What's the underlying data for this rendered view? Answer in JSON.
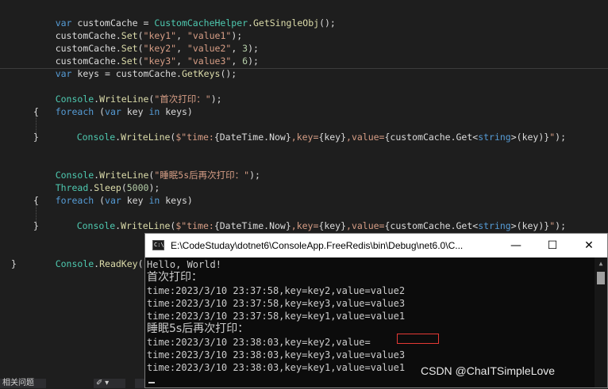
{
  "code": {
    "line1_a": "var",
    "line1_b": " customCache = ",
    "line1_c": "CustomCacheHelper",
    "line1_d": ".",
    "line1_e": "GetSingleObj",
    "line1_f": "();",
    "line2_a": "customCache.",
    "line2_b": "Set",
    "line2_c": "(",
    "line2_d": "\"key1\"",
    "line2_e": ", ",
    "line2_f": "\"value1\"",
    "line2_g": ");",
    "line3_a": "customCache.",
    "line3_b": "Set",
    "line3_c": "(",
    "line3_d": "\"key2\"",
    "line3_e": ", ",
    "line3_f": "\"value2\"",
    "line3_g": ", ",
    "line3_h": "3",
    "line3_i": ");",
    "line4_a": "customCache.",
    "line4_b": "Set",
    "line4_c": "(",
    "line4_d": "\"key3\"",
    "line4_e": ", ",
    "line4_f": "\"value3\"",
    "line4_g": ", ",
    "line4_h": "6",
    "line4_i": ");",
    "line5_a": "var",
    "line5_b": " keys = customCache.",
    "line5_c": "GetKeys",
    "line5_d": "();",
    "line6_a": "Console",
    "line6_b": ".",
    "line6_c": "WriteLine",
    "line6_d": "(",
    "line6_e": "\"首次打印：\"",
    "line6_f": ");",
    "line7_a": "foreach",
    "line7_b": " (",
    "line7_c": "var",
    "line7_d": " key ",
    "line7_e": "in",
    "line7_f": " keys)",
    "brace_open": "{",
    "brace_close": "}",
    "wl_a": "Console",
    "wl_b": ".",
    "wl_c": "WriteLine",
    "wl_d": "(",
    "wl_e": "$\"time:",
    "wl_f": "{DateTime.Now}",
    "wl_g": ",key=",
    "wl_h": "{key}",
    "wl_i": ",value=",
    "wl_j": "{customCache.Get<",
    "wl_k": "string",
    "wl_l": ">(key)}",
    "wl_m": "\"",
    "wl_n": ");",
    "line8_a": "Console",
    "line8_b": ".",
    "line8_c": "WriteLine",
    "line8_d": "(",
    "line8_e": "\"睡眠5s后再次打印：\"",
    "line8_f": ");",
    "line9_a": "Thread",
    "line9_b": ".",
    "line9_c": "Sleep",
    "line9_d": "(",
    "line9_e": "5000",
    "line9_f": ");",
    "line10_a": "Console",
    "line10_b": ".",
    "line10_c": "ReadKey",
    "line10_d": "();",
    "final_brace": "}"
  },
  "bottom_tabs": {
    "related_issues": "相关问题"
  },
  "console": {
    "title": "E:\\CodeStuday\\dotnet6\\ConsoleApp.FreeRedis\\bin\\Debug\\net6.0\\C...",
    "icon_label": "C:\\",
    "minimize": "—",
    "maximize": "☐",
    "close": "✕",
    "lines": [
      "Hello, World!",
      "首次打印：",
      "time:2023/3/10 23:37:58,key=key2,value=value2",
      "time:2023/3/10 23:37:58,key=key3,value=value3",
      "time:2023/3/10 23:37:58,key=key1,value=value1",
      "睡眠5s后再次打印：",
      "time:2023/3/10 23:38:03,key=key2,value=",
      "time:2023/3/10 23:38:03,key=key3,value=value3",
      "time:2023/3/10 23:38:03,key=key1,value=value1"
    ]
  },
  "watermark": "CSDN @ChaITSimpleLove",
  "colors": {
    "keyword": "#569cd6",
    "type": "#4ec9b0",
    "method": "#dcdcaa",
    "string": "#d69d85",
    "number": "#b5cea8",
    "highlight_box": "#e53935"
  }
}
